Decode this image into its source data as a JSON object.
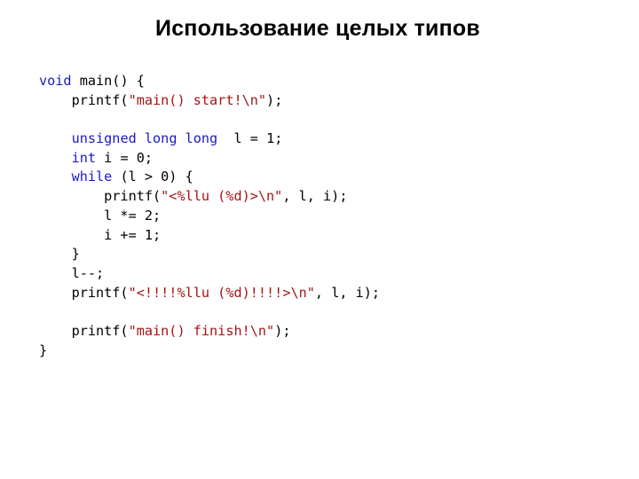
{
  "slide": {
    "title": "Использование целых типов"
  },
  "code": {
    "colors": {
      "keyword": "#1a1ac8",
      "string": "#a31515",
      "text": "#000000"
    },
    "lines": [
      [
        {
          "t": "void",
          "c": "kw"
        },
        {
          "t": " main() {",
          "c": ""
        }
      ],
      [
        {
          "t": "    printf(",
          "c": ""
        },
        {
          "t": "\"main() start!\\n\"",
          "c": "str"
        },
        {
          "t": ");",
          "c": ""
        }
      ],
      [],
      [
        {
          "t": "    ",
          "c": ""
        },
        {
          "t": "unsigned",
          "c": "kw"
        },
        {
          "t": " ",
          "c": ""
        },
        {
          "t": "long",
          "c": "kw"
        },
        {
          "t": " ",
          "c": ""
        },
        {
          "t": "long",
          "c": "kw"
        },
        {
          "t": "  l = 1;",
          "c": ""
        }
      ],
      [
        {
          "t": "    ",
          "c": ""
        },
        {
          "t": "int",
          "c": "kw"
        },
        {
          "t": " i = 0;",
          "c": ""
        }
      ],
      [
        {
          "t": "    ",
          "c": ""
        },
        {
          "t": "while",
          "c": "kw"
        },
        {
          "t": " (l > 0) {",
          "c": ""
        }
      ],
      [
        {
          "t": "        printf(",
          "c": ""
        },
        {
          "t": "\"<%llu (%d)>\\n\"",
          "c": "str"
        },
        {
          "t": ", l, i);",
          "c": ""
        }
      ],
      [
        {
          "t": "        l *= 2;",
          "c": ""
        }
      ],
      [
        {
          "t": "        i += 1;",
          "c": ""
        }
      ],
      [
        {
          "t": "    }",
          "c": ""
        }
      ],
      [
        {
          "t": "    l--;",
          "c": ""
        }
      ],
      [
        {
          "t": "    printf(",
          "c": ""
        },
        {
          "t": "\"<!!!!%llu (%d)!!!!>\\n\"",
          "c": "str"
        },
        {
          "t": ", l, i);",
          "c": ""
        }
      ],
      [],
      [
        {
          "t": "    printf(",
          "c": ""
        },
        {
          "t": "\"main() finish!\\n\"",
          "c": "str"
        },
        {
          "t": ");",
          "c": ""
        }
      ],
      [
        {
          "t": "}",
          "c": ""
        }
      ]
    ]
  }
}
